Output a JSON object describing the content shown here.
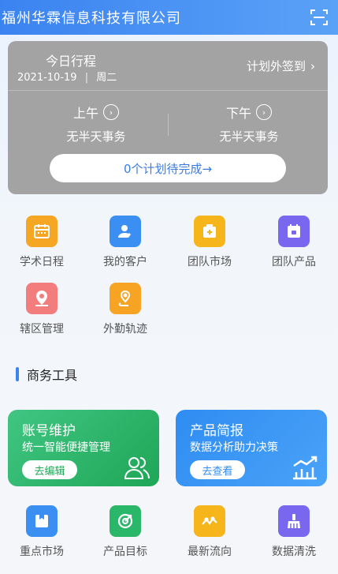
{
  "header": {
    "title": "福州华霖信息科技有限公司",
    "scan_icon": "scan-icon"
  },
  "schedule": {
    "title": "今日行程",
    "date": "2021-10-19",
    "separator": "|",
    "weekday": "周二",
    "link_label": "计划外签到",
    "morning": {
      "label": "上午",
      "status": "无半天事务"
    },
    "afternoon": {
      "label": "下午",
      "status": "无半天事务"
    },
    "pending_label": "0个计划待完成→"
  },
  "shortcuts": [
    {
      "label": "学术日程",
      "icon": "calendar-icon",
      "color": "#f5a623"
    },
    {
      "label": "我的客户",
      "icon": "client-icon",
      "color": "#3b8ff3"
    },
    {
      "label": "团队市场",
      "icon": "market-icon",
      "color": "#f7b51c"
    },
    {
      "label": "团队产品",
      "icon": "product-icon",
      "color": "#7a67f0"
    },
    {
      "label": "辖区管理",
      "icon": "region-icon",
      "color": "#f37d7d"
    },
    {
      "label": "外勤轨迹",
      "icon": "track-icon",
      "color": "#f7a324"
    }
  ],
  "business": {
    "title": "商务工具",
    "cards": [
      {
        "title": "账号维护",
        "subtitle": "统一智能便捷管理",
        "button": "去编辑",
        "icon": "users-icon",
        "color": "#2bb76a"
      },
      {
        "title": "产品简报",
        "subtitle": "数据分析助力决策",
        "button": "去查看",
        "icon": "trend-chart-icon",
        "color": "#2f8cf1"
      }
    ],
    "tools": [
      {
        "label": "重点市场",
        "icon": "key-market-icon",
        "color": "#3b8ff3"
      },
      {
        "label": "产品目标",
        "icon": "target-icon",
        "color": "#2bb76a"
      },
      {
        "label": "最新流向",
        "icon": "flow-icon",
        "color": "#f7b51c"
      },
      {
        "label": "数据清洗",
        "icon": "cleaning-icon",
        "color": "#7a67f0"
      }
    ]
  }
}
